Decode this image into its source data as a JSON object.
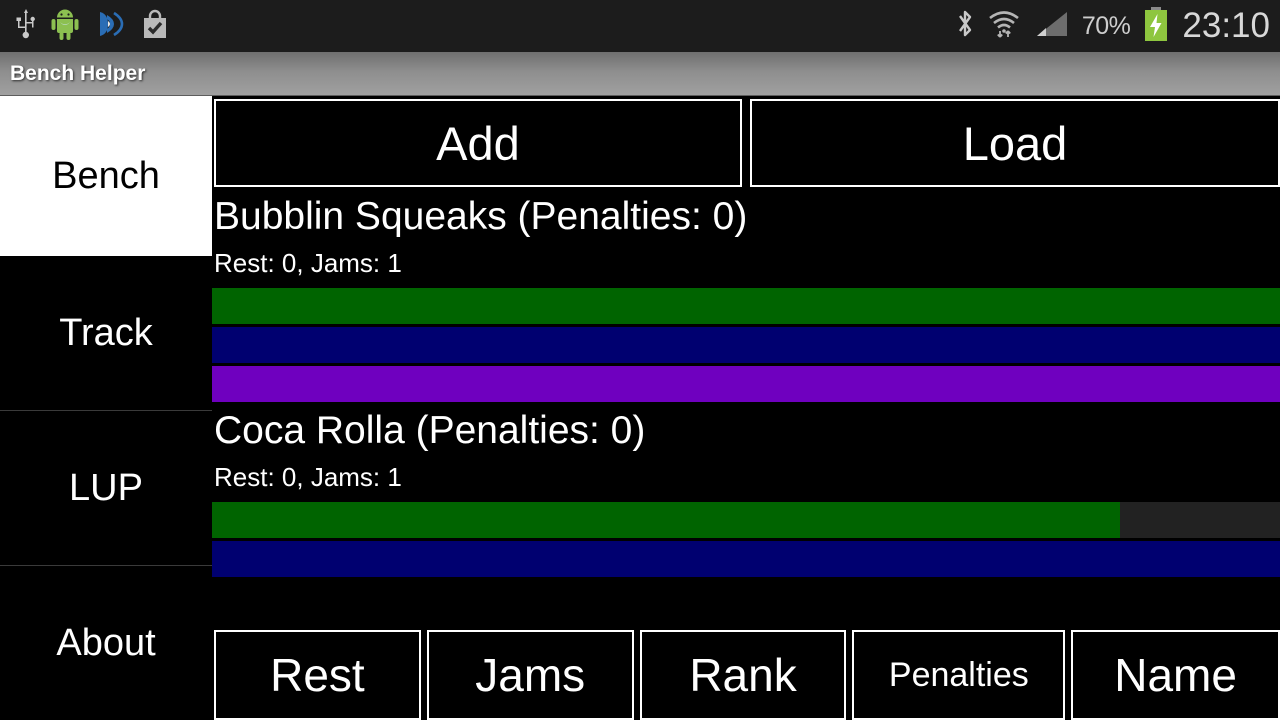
{
  "status_bar": {
    "icons_left": [
      "usb-icon",
      "android-robot-icon",
      "nfc-icon",
      "play-store-bag-icon"
    ],
    "icons_right": [
      "bluetooth-icon",
      "wifi-icon",
      "cellular-signal-icon",
      "battery-charging-icon"
    ],
    "battery_percent": "70%",
    "clock": "23:10"
  },
  "title_bar": {
    "app_title": "Bench Helper"
  },
  "sidebar": {
    "tabs": [
      {
        "label": "Bench",
        "active": true
      },
      {
        "label": "Track",
        "active": false
      },
      {
        "label": "LUP",
        "active": false
      },
      {
        "label": "About",
        "active": false
      }
    ]
  },
  "actions": {
    "add_label": "Add",
    "load_label": "Load"
  },
  "colors": {
    "bar_green": "#006400",
    "bar_navy": "#000070",
    "bar_purple": "#6f00bf",
    "bar_track": "#222222",
    "accent_white": "#ffffff",
    "background": "#000000"
  },
  "skaters": [
    {
      "name": "Bubblin Squeaks (Penalties: 0)",
      "stats": "Rest: 0, Jams: 1",
      "bars": [
        {
          "name": "green-bar",
          "color": "#006400",
          "percent": 100
        },
        {
          "name": "navy-bar",
          "color": "#000070",
          "percent": 100
        },
        {
          "name": "purple-bar",
          "color": "#6f00bf",
          "percent": 100
        }
      ]
    },
    {
      "name": "Coca Rolla (Penalties: 0)",
      "stats": "Rest: 0, Jams: 1",
      "bars": [
        {
          "name": "green-bar",
          "color": "#006400",
          "percent": 85
        },
        {
          "name": "navy-bar",
          "color": "#000070",
          "percent": 100
        }
      ]
    }
  ],
  "bottom_buttons": [
    {
      "label": "Rest"
    },
    {
      "label": "Jams"
    },
    {
      "label": "Rank"
    },
    {
      "label": "Penalties"
    },
    {
      "label": "Name"
    }
  ]
}
